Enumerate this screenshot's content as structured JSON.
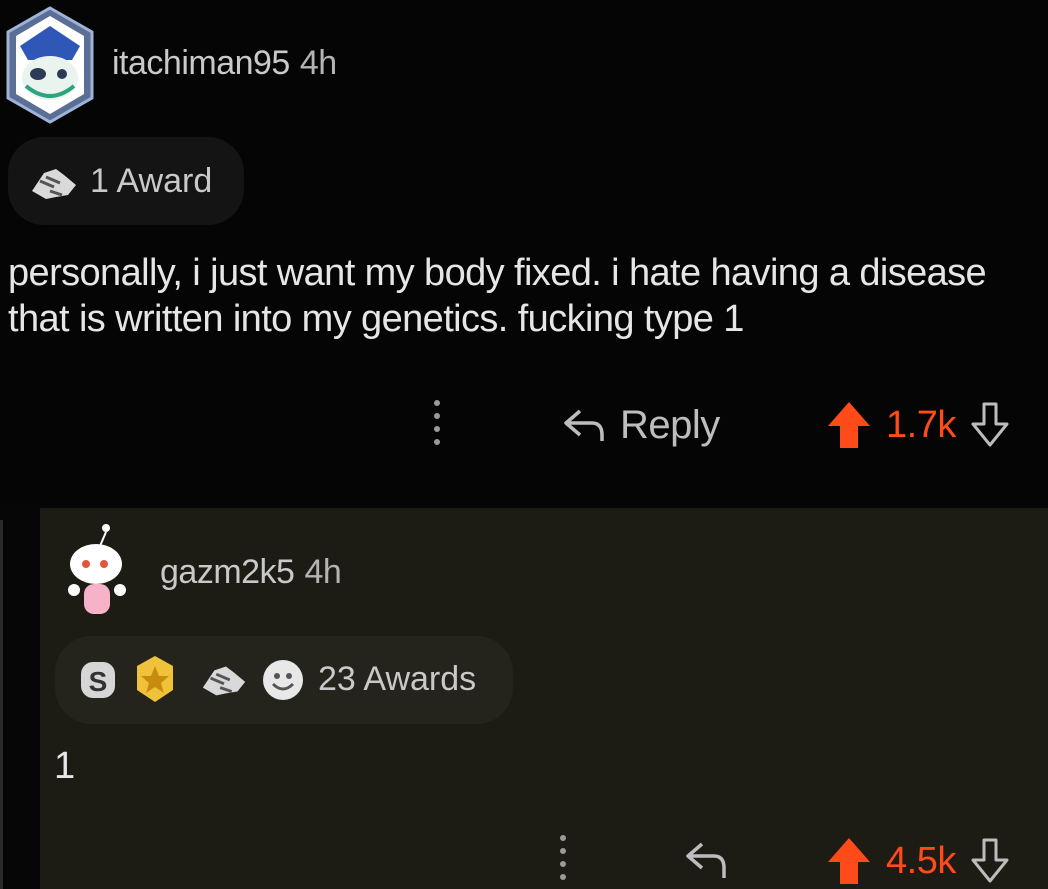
{
  "comments": [
    {
      "author": "itachiman95",
      "time": "4h",
      "awards_label": "1 Award",
      "text": "personally, i just want my body fixed. i hate having a disease that is written into my genetics. fucking type 1",
      "reply_label": "Reply",
      "score": "1.7k",
      "award_icons": [
        "handshake-award-icon"
      ]
    },
    {
      "author": "gazm2k5",
      "time": "4h",
      "awards_label": "23 Awards",
      "text": "1",
      "score": "4.5k",
      "award_icons": [
        "silver-award-icon",
        "gold-award-icon",
        "handshake-award-icon",
        "wholesome-award-icon"
      ]
    }
  ],
  "colors": {
    "upvote": "#ff4a1a",
    "background": "#060606",
    "reply_background": "#1c1b14"
  }
}
